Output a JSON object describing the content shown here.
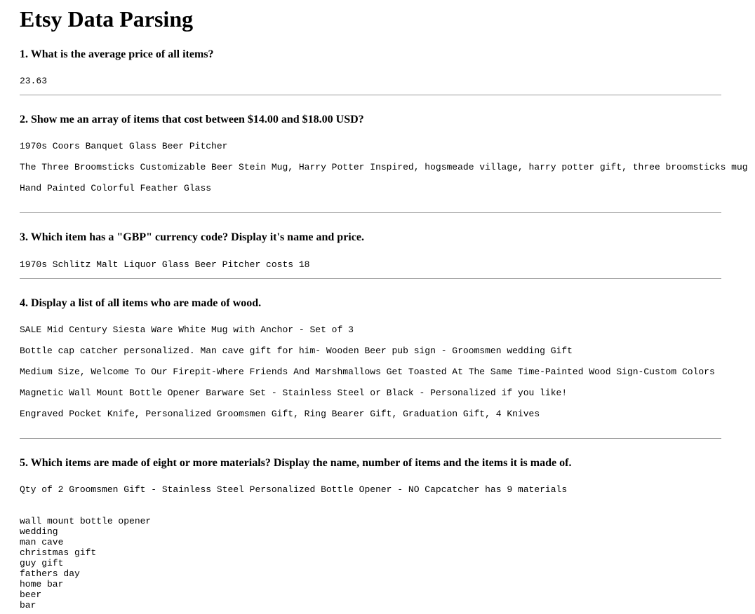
{
  "page": {
    "title": "Etsy Data Parsing"
  },
  "q1": {
    "question": "1. What is the average price of all items?",
    "answer": "23.63"
  },
  "q2": {
    "question": "2. Show me an array of items that cost between $14.00 and $18.00 USD?",
    "items": [
      "1970s Coors Banquet Glass Beer Pitcher",
      "The Three Broomsticks Customizable Beer Stein Mug, Harry Potter Inspired, hogsmeade village, harry potter gift, three broomsticks mug",
      "Hand Painted Colorful Feather Glass"
    ]
  },
  "q3": {
    "question": "3. Which item has a \"GBP\" currency code? Display it's name and price.",
    "answer": "1970s Schlitz Malt Liquor Glass Beer Pitcher costs 18"
  },
  "q4": {
    "question": "4. Display a list of all items who are made of wood.",
    "items": [
      "SALE Mid Century Siesta Ware White Mug with Anchor - Set of 3",
      "Bottle cap catcher personalized. Man cave gift for him- Wooden Beer pub sign - Groomsmen wedding Gift",
      "Medium Size, Welcome To Our Firepit-Where Friends And Marshmallows Get Toasted At The Same Time-Painted Wood Sign-Custom Colors",
      "Magnetic Wall Mount Bottle Opener Barware Set - Stainless Steel or Black - Personalized if you like!",
      "Engraved Pocket Knife, Personalized Groomsmen Gift, Ring Bearer Gift, Graduation Gift, 4 Knives"
    ]
  },
  "q5": {
    "question": "5. Which items are made of eight or more materials? Display the name, number of items and the items it is made of.",
    "answer": "Qty of 2 Groomsmen Gift - Stainless Steel Personalized Bottle Opener - NO Capcatcher has 9 materials",
    "materials": [
      "wall mount bottle opener",
      "wedding",
      "man cave",
      "christmas gift",
      "guy gift",
      "fathers day",
      "home bar",
      "beer",
      "bar"
    ]
  }
}
